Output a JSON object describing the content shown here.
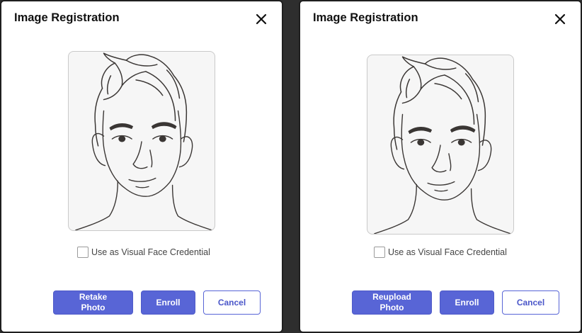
{
  "dialogs": [
    {
      "title": "Image Registration",
      "close_icon": "close-icon",
      "photo": "face-illustration",
      "checkbox_label": "Use as Visual Face Credential",
      "checkbox_checked": false,
      "buttons": {
        "primary_label": "Retake\nPhoto",
        "enroll_label": "Enroll",
        "cancel_label": "Cancel"
      }
    },
    {
      "title": "Image Registration",
      "close_icon": "close-icon",
      "photo": "face-illustration",
      "checkbox_label": "Use as Visual Face Credential",
      "checkbox_checked": false,
      "buttons": {
        "primary_label": "Reupload\nPhoto",
        "enroll_label": "Enroll",
        "cancel_label": "Cancel"
      }
    }
  ],
  "colors": {
    "primary": "#5865d6",
    "outline_text": "#4a56c9",
    "title_text": "#111111",
    "label_text": "#444444"
  }
}
